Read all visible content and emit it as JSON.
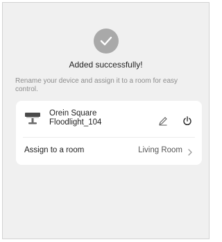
{
  "success": {
    "title": "Added successfully!",
    "check_color": "#a9a9a9"
  },
  "description": "Rename your device and assign it to a room for easy control.",
  "device": {
    "name_line1": "Orein Square",
    "name_line2": "Floodlight_104",
    "icon": "floodlight-icon",
    "edit_icon": "pencil-icon",
    "power_icon": "power-icon"
  },
  "room": {
    "label": "Assign to a room",
    "value": "Living Room",
    "chevron_icon": "chevron-right-icon"
  }
}
